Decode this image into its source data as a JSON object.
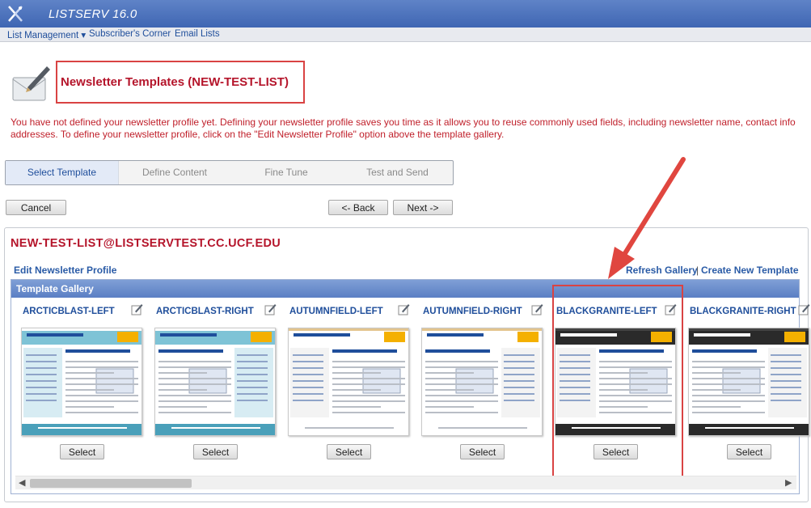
{
  "app": {
    "title": "LISTSERV 16.0"
  },
  "menu": {
    "items": [
      "List Management ▾",
      "Subscriber's Corner",
      "Email Lists"
    ]
  },
  "page": {
    "title": "Newsletter Templates (NEW-TEST-LIST)",
    "warning_line1": "You have not defined your newsletter profile yet. Defining your newsletter profile saves you time as it allows you to reuse commonly used fields, including newsletter name, contact info",
    "warning_line2": "addresses. To define your newsletter profile, click on the \"Edit Newsletter Profile\" option above the template gallery."
  },
  "steps": [
    "Select Template",
    "Define Content",
    "Fine Tune",
    "Test and Send"
  ],
  "buttons": {
    "cancel": "Cancel",
    "back": "<- Back",
    "next": "Next ->"
  },
  "list": {
    "address": "NEW-TEST-LIST@LISTSERVTEST.CC.UCF.EDU",
    "edit_profile": "Edit Newsletter Profile",
    "refresh": "Refresh Gallery",
    "separator": "|",
    "create": "Create New Template"
  },
  "gallery": {
    "heading": "Template Gallery",
    "select_label": "Select",
    "templates": [
      {
        "name": "ARCTICBLAST-LEFT",
        "theme": "arctic",
        "newsletter": "L-Soft Newsletter | Issue 1, 2009"
      },
      {
        "name": "ARCTICBLAST-RIGHT",
        "theme": "arctic",
        "newsletter": "L-Soft Newsletter | Issue 1, 2009"
      },
      {
        "name": "AUTUMNFIELD-LEFT",
        "theme": "autumn",
        "newsletter": "L-Soft Newsletter | Issue 1, 2009"
      },
      {
        "name": "AUTUMNFIELD-RIGHT",
        "theme": "autumn",
        "newsletter": "L-Soft Newsletter | Issue 1, 2009"
      },
      {
        "name": "BLACKGRANITE-LEFT",
        "theme": "granite",
        "newsletter": "L-Soft Newsletter | Issue 1, 2009"
      },
      {
        "name": "BLACKGRANITE-RIGHT",
        "theme": "granite",
        "newsletter": "L-Soft Newsletter | Issue 1, 2009"
      }
    ]
  },
  "colors": {
    "accent_red": "#d94343",
    "link_blue": "#1f4e9b",
    "title_red": "#b5152b",
    "header_blue": "#4a6fb8"
  }
}
